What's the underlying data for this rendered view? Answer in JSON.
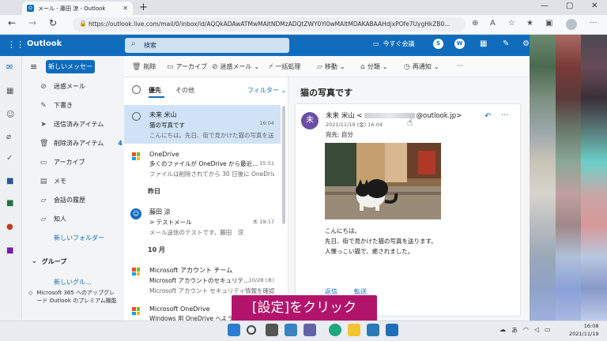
{
  "browser": {
    "tab_title": "メール - 藤田 涼 - Outlook",
    "url": "https://outlook.live.com/mail/0/inbox/id/AQQkADAwATMwMAItNDMzADQtZWY0Yi0wMAItMDAKABAAHdjxPOfe7UygHkZB0...",
    "favicon_text": "O"
  },
  "header": {
    "brand": "Outlook",
    "search_placeholder": "検索",
    "meet_now": "今すぐ会議",
    "badge_s": "S",
    "badge_w": "W"
  },
  "folder_pane": {
    "new_mail": "新しいメッセージ",
    "folders": [
      {
        "label": "迷惑メール",
        "icon": "junk-icon",
        "count": ""
      },
      {
        "label": "下書き",
        "icon": "pencil-icon",
        "count": ""
      },
      {
        "label": "送信済みアイテム",
        "icon": "send-icon",
        "count": ""
      },
      {
        "label": "削除済みアイテム",
        "icon": "trash-icon",
        "count": "4"
      },
      {
        "label": "アーカイブ",
        "icon": "archive-icon",
        "count": ""
      },
      {
        "label": "メモ",
        "icon": "note-icon",
        "count": ""
      },
      {
        "label": "会話の履歴",
        "icon": "folder-icon",
        "count": ""
      },
      {
        "label": "知人",
        "icon": "folder-icon",
        "count": ""
      }
    ],
    "new_folder": "新しいフォルダー",
    "group_header": "グループ",
    "new_group": "新しいグル...",
    "promo": "Microsoft 365 へのアップグレード Outlook のプレミアム機能"
  },
  "command_bar": {
    "delete": "削除",
    "archive": "アーカイブ",
    "junk": "迷惑メール",
    "sweep": "一括処理",
    "move": "移動",
    "categorize": "分類",
    "snooze": "再通知",
    "more": "···"
  },
  "message_list": {
    "tab_focused": "優先",
    "tab_other": "その他",
    "filter": "フィルター",
    "group_yesterday": "昨日",
    "group_october": "10 月",
    "messages": [
      {
        "from": "未来 米山",
        "subject": "猫の写真です",
        "preview": "こんにちは。先日、街で見かけた猫の写真を送",
        "time": "16:04"
      },
      {
        "from": "OneDrive",
        "subject": "多くのファイルが OneDrive から最近...",
        "preview": "ファイルは削除されてから 30 日後に OneDriv...",
        "time": "15:51"
      },
      {
        "from": "藤田 涼",
        "subject": "> テストメール",
        "preview": "メール送信のテストです。藤田　涼",
        "time": "木 19:17"
      },
      {
        "from": "Microsoft アカウント チーム",
        "subject": "Microsoft アカウントのセキュリテ...",
        "preview": "Microsoft アカウント セキュリティ情報を確認...",
        "time": "10/28 (木)"
      },
      {
        "from": "Microsoft OneDrive",
        "subject": "Windows 用 OneDrive へようこそ",
        "preview": "",
        "time": ""
      }
    ]
  },
  "reading_pane": {
    "subject": "猫の写真です",
    "sender_initial": "未",
    "sender_name": "未来 米山 <",
    "sender_domain": "@outlook.jp>",
    "date": "2021/11/19 (金) 16:04",
    "to": "宛先: 自分",
    "body": [
      "こんにちは。",
      "先日、街で見かけた猫の写真を送ります。",
      "人懐っこい猫で、癒されました。"
    ],
    "reply": "返信",
    "forward": "転送"
  },
  "caption": "[設定]をクリック",
  "taskbar": {
    "time": "16:08",
    "date": "2021/11/19",
    "ime": "あ"
  },
  "colors": {
    "outlook_blue": "#0f6cbd",
    "caption_bg": "#b3146b",
    "selected_row": "#cfe2f7"
  }
}
